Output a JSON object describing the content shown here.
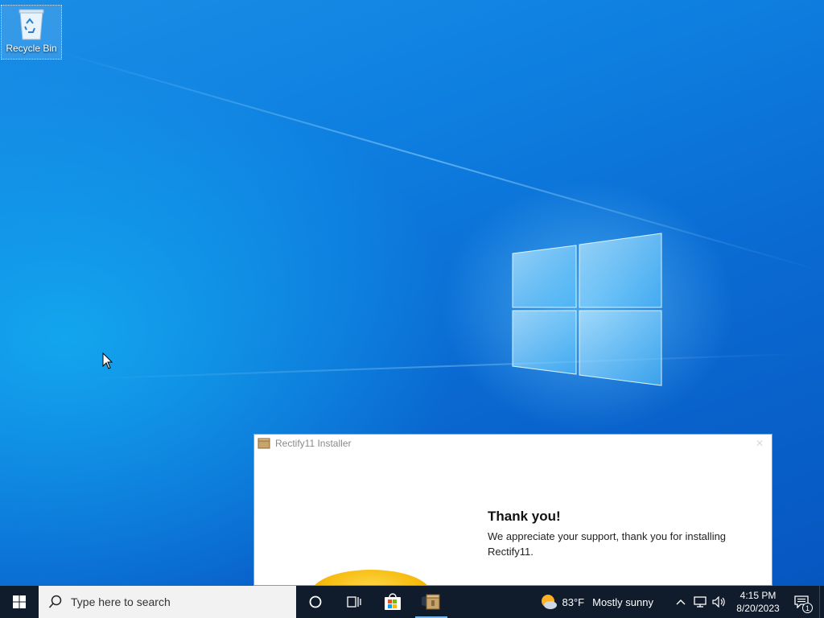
{
  "desktop": {
    "icons": [
      {
        "label": "Recycle Bin",
        "icon": "recycle-bin-icon"
      }
    ]
  },
  "installer": {
    "title": "Rectify11 Installer",
    "heading": "Thank you!",
    "message": "We appreciate your support, thank you for installing Rectify11."
  },
  "taskbar": {
    "search_placeholder": "Type here to search",
    "apps": [
      "cortana-icon",
      "task-view-icon",
      "microsoft-store-icon",
      "installer-app-icon"
    ],
    "weather": {
      "temp": "83°F",
      "condition": "Mostly sunny"
    },
    "clock": {
      "time": "4:15 PM",
      "date": "8/20/2023"
    },
    "notification_count": "1"
  },
  "colors": {
    "taskbar": "#101c2c",
    "accent": "#76b9ed"
  }
}
